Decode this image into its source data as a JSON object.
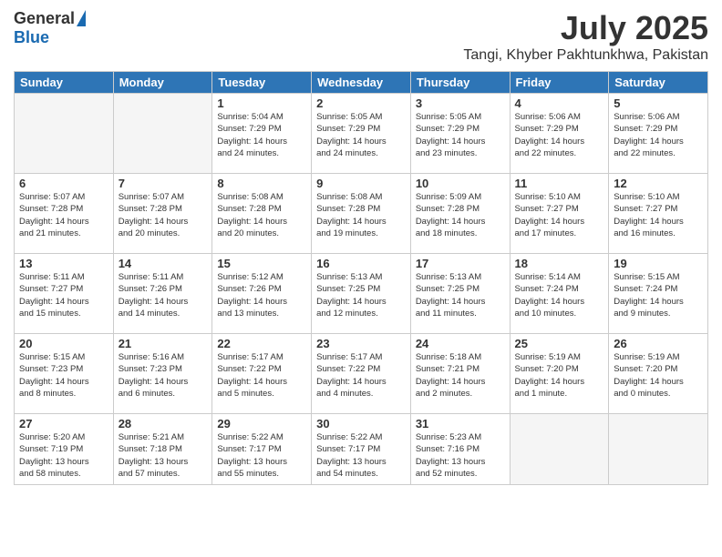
{
  "header": {
    "logo_general": "General",
    "logo_blue": "Blue",
    "title": "July 2025",
    "location": "Tangi, Khyber Pakhtunkhwa, Pakistan"
  },
  "weekdays": [
    "Sunday",
    "Monday",
    "Tuesday",
    "Wednesday",
    "Thursday",
    "Friday",
    "Saturday"
  ],
  "weeks": [
    [
      {
        "day": "",
        "info": ""
      },
      {
        "day": "",
        "info": ""
      },
      {
        "day": "1",
        "info": "Sunrise: 5:04 AM\nSunset: 7:29 PM\nDaylight: 14 hours\nand 24 minutes."
      },
      {
        "day": "2",
        "info": "Sunrise: 5:05 AM\nSunset: 7:29 PM\nDaylight: 14 hours\nand 24 minutes."
      },
      {
        "day": "3",
        "info": "Sunrise: 5:05 AM\nSunset: 7:29 PM\nDaylight: 14 hours\nand 23 minutes."
      },
      {
        "day": "4",
        "info": "Sunrise: 5:06 AM\nSunset: 7:29 PM\nDaylight: 14 hours\nand 22 minutes."
      },
      {
        "day": "5",
        "info": "Sunrise: 5:06 AM\nSunset: 7:29 PM\nDaylight: 14 hours\nand 22 minutes."
      }
    ],
    [
      {
        "day": "6",
        "info": "Sunrise: 5:07 AM\nSunset: 7:28 PM\nDaylight: 14 hours\nand 21 minutes."
      },
      {
        "day": "7",
        "info": "Sunrise: 5:07 AM\nSunset: 7:28 PM\nDaylight: 14 hours\nand 20 minutes."
      },
      {
        "day": "8",
        "info": "Sunrise: 5:08 AM\nSunset: 7:28 PM\nDaylight: 14 hours\nand 20 minutes."
      },
      {
        "day": "9",
        "info": "Sunrise: 5:08 AM\nSunset: 7:28 PM\nDaylight: 14 hours\nand 19 minutes."
      },
      {
        "day": "10",
        "info": "Sunrise: 5:09 AM\nSunset: 7:28 PM\nDaylight: 14 hours\nand 18 minutes."
      },
      {
        "day": "11",
        "info": "Sunrise: 5:10 AM\nSunset: 7:27 PM\nDaylight: 14 hours\nand 17 minutes."
      },
      {
        "day": "12",
        "info": "Sunrise: 5:10 AM\nSunset: 7:27 PM\nDaylight: 14 hours\nand 16 minutes."
      }
    ],
    [
      {
        "day": "13",
        "info": "Sunrise: 5:11 AM\nSunset: 7:27 PM\nDaylight: 14 hours\nand 15 minutes."
      },
      {
        "day": "14",
        "info": "Sunrise: 5:11 AM\nSunset: 7:26 PM\nDaylight: 14 hours\nand 14 minutes."
      },
      {
        "day": "15",
        "info": "Sunrise: 5:12 AM\nSunset: 7:26 PM\nDaylight: 14 hours\nand 13 minutes."
      },
      {
        "day": "16",
        "info": "Sunrise: 5:13 AM\nSunset: 7:25 PM\nDaylight: 14 hours\nand 12 minutes."
      },
      {
        "day": "17",
        "info": "Sunrise: 5:13 AM\nSunset: 7:25 PM\nDaylight: 14 hours\nand 11 minutes."
      },
      {
        "day": "18",
        "info": "Sunrise: 5:14 AM\nSunset: 7:24 PM\nDaylight: 14 hours\nand 10 minutes."
      },
      {
        "day": "19",
        "info": "Sunrise: 5:15 AM\nSunset: 7:24 PM\nDaylight: 14 hours\nand 9 minutes."
      }
    ],
    [
      {
        "day": "20",
        "info": "Sunrise: 5:15 AM\nSunset: 7:23 PM\nDaylight: 14 hours\nand 8 minutes."
      },
      {
        "day": "21",
        "info": "Sunrise: 5:16 AM\nSunset: 7:23 PM\nDaylight: 14 hours\nand 6 minutes."
      },
      {
        "day": "22",
        "info": "Sunrise: 5:17 AM\nSunset: 7:22 PM\nDaylight: 14 hours\nand 5 minutes."
      },
      {
        "day": "23",
        "info": "Sunrise: 5:17 AM\nSunset: 7:22 PM\nDaylight: 14 hours\nand 4 minutes."
      },
      {
        "day": "24",
        "info": "Sunrise: 5:18 AM\nSunset: 7:21 PM\nDaylight: 14 hours\nand 2 minutes."
      },
      {
        "day": "25",
        "info": "Sunrise: 5:19 AM\nSunset: 7:20 PM\nDaylight: 14 hours\nand 1 minute."
      },
      {
        "day": "26",
        "info": "Sunrise: 5:19 AM\nSunset: 7:20 PM\nDaylight: 14 hours\nand 0 minutes."
      }
    ],
    [
      {
        "day": "27",
        "info": "Sunrise: 5:20 AM\nSunset: 7:19 PM\nDaylight: 13 hours\nand 58 minutes."
      },
      {
        "day": "28",
        "info": "Sunrise: 5:21 AM\nSunset: 7:18 PM\nDaylight: 13 hours\nand 57 minutes."
      },
      {
        "day": "29",
        "info": "Sunrise: 5:22 AM\nSunset: 7:17 PM\nDaylight: 13 hours\nand 55 minutes."
      },
      {
        "day": "30",
        "info": "Sunrise: 5:22 AM\nSunset: 7:17 PM\nDaylight: 13 hours\nand 54 minutes."
      },
      {
        "day": "31",
        "info": "Sunrise: 5:23 AM\nSunset: 7:16 PM\nDaylight: 13 hours\nand 52 minutes."
      },
      {
        "day": "",
        "info": ""
      },
      {
        "day": "",
        "info": ""
      }
    ]
  ]
}
